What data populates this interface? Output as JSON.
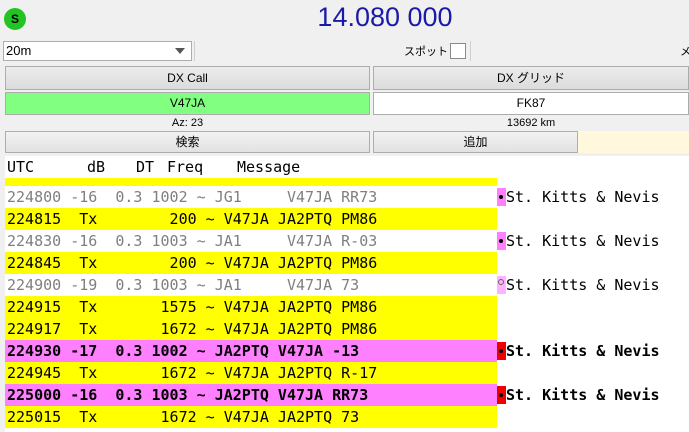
{
  "status_badge": "S",
  "frequency": "14.080 000",
  "band": "20m",
  "spot_label": "スポット",
  "me_label": "メ",
  "dx_call_header": "DX Call",
  "dx_grid_header": "DX グリッド",
  "dx_call": "V47JA",
  "dx_grid": "FK87",
  "azimuth": "Az: 23",
  "distance": "13692 km",
  "search_button": "検索",
  "add_button": "追加",
  "colors": {
    "frequency_text": "#1a1aa8",
    "dx_call_bg": "#80ff80",
    "tx_row": "#ffff00",
    "highlight_row": "#ff80ff",
    "marker_magenta": "#ff80ff",
    "marker_red": "#ee0000"
  },
  "list": {
    "headers": {
      "utc": "UTC",
      "db": "dB",
      "dt": "DT",
      "freq": "Freq",
      "message": "Message"
    },
    "rows": [
      {
        "type": "rx",
        "text": "224800 -16  0.3 1002 ~ JG1     V47JA RR73",
        "marker": "magenta",
        "country": "St. Kitts & Nevis"
      },
      {
        "type": "tx",
        "text": "224815  Tx        200 ~ V47JA JA2PTQ PM86",
        "marker": "",
        "country": ""
      },
      {
        "type": "rx",
        "text": "224830 -16  0.3 1003 ~ JA1     V47JA R-03",
        "marker": "magenta",
        "country": "St. Kitts & Nevis"
      },
      {
        "type": "tx",
        "text": "224845  Tx        200 ~ V47JA JA2PTQ PM86",
        "marker": "",
        "country": ""
      },
      {
        "type": "rx",
        "text": "224900 -19  0.3 1003 ~ JA1     V47JA 73",
        "marker": "magenta-open",
        "country": "St. Kitts & Nevis"
      },
      {
        "type": "tx",
        "text": "224915  Tx       1575 ~ V47JA JA2PTQ PM86",
        "marker": "",
        "country": ""
      },
      {
        "type": "tx",
        "text": "224917  Tx       1672 ~ V47JA JA2PTQ PM86",
        "marker": "",
        "country": ""
      },
      {
        "type": "hl",
        "text": "224930 -17  0.3 1002 ~ JA2PTQ V47JA -13",
        "marker": "red",
        "country": "St. Kitts & Nevis"
      },
      {
        "type": "tx",
        "text": "224945  Tx       1672 ~ V47JA JA2PTQ R-17",
        "marker": "",
        "country": ""
      },
      {
        "type": "hl",
        "text": "225000 -16  0.3 1003 ~ JA2PTQ V47JA RR73",
        "marker": "red",
        "country": "St. Kitts & Nevis"
      },
      {
        "type": "tx",
        "text": "225015  Tx       1672 ~ V47JA JA2PTQ 73",
        "marker": "",
        "country": ""
      }
    ]
  }
}
